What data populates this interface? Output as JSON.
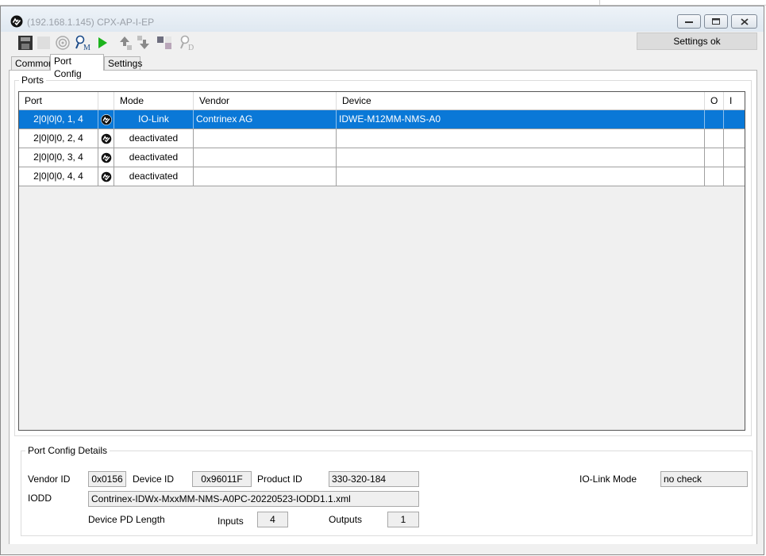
{
  "window": {
    "title": "(192.168.1.145) CPX-AP-I-EP"
  },
  "toolbar": {
    "status_text": "Settings ok",
    "icons": [
      "save-icon",
      "blank-icon",
      "target-icon",
      "search-m-icon",
      "play-icon",
      "upload-icon",
      "download-icon",
      "grid-icon",
      "search-d-icon"
    ]
  },
  "tabs": [
    {
      "label": "Common",
      "active": false
    },
    {
      "label": "Port Config",
      "active": true
    },
    {
      "label": "Settings",
      "active": false
    }
  ],
  "ports": {
    "group_title": "Ports",
    "columns": {
      "port": "Port",
      "mode": "Mode",
      "vendor": "Vendor",
      "device": "Device",
      "o": "O",
      "i": "I"
    },
    "rows": [
      {
        "port": "2|0|0|0, 1, 4",
        "mode": "IO-Link",
        "vendor": "Contrinex AG",
        "device": "IDWE-M12MM-NMS-A0",
        "o": "",
        "i": "",
        "selected": true
      },
      {
        "port": "2|0|0|0, 2, 4",
        "mode": "deactivated",
        "vendor": "",
        "device": "",
        "o": "",
        "i": "",
        "selected": false
      },
      {
        "port": "2|0|0|0, 3, 4",
        "mode": "deactivated",
        "vendor": "",
        "device": "",
        "o": "",
        "i": "",
        "selected": false
      },
      {
        "port": "2|0|0|0, 4, 4",
        "mode": "deactivated",
        "vendor": "",
        "device": "",
        "o": "",
        "i": "",
        "selected": false
      }
    ]
  },
  "details": {
    "group_title": "Port Config Details",
    "vendor_id_label": "Vendor ID",
    "vendor_id": "0x0156",
    "device_id_label": "Device ID",
    "device_id": "0x96011F",
    "product_id_label": "Product ID",
    "product_id": "330-320-184",
    "iolink_mode_label": "IO-Link Mode",
    "iolink_mode": "no check",
    "iodd_label": "IODD",
    "iodd": "Contrinex-IDWx-MxxMM-NMS-A0PC-20220523-IODD1.1.xml",
    "pd_length_label": "Device PD Length",
    "inputs_label": "Inputs",
    "inputs": "4",
    "outputs_label": "Outputs",
    "outputs": "1"
  },
  "colors": {
    "selection": "#0a78d7",
    "play": "#1db31d"
  }
}
